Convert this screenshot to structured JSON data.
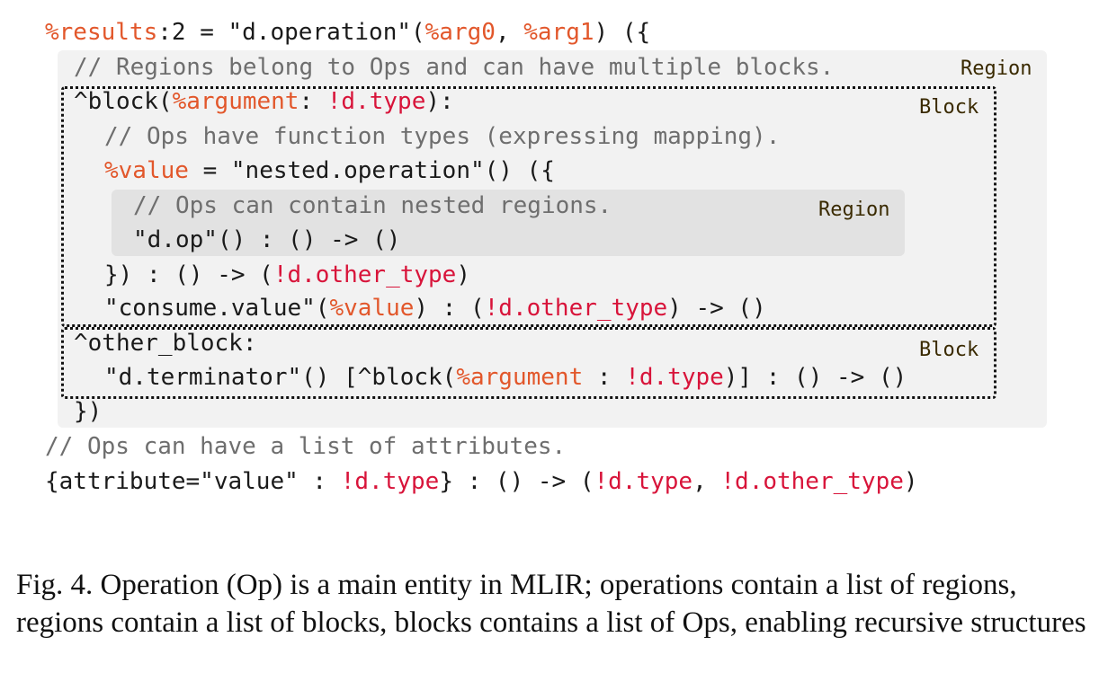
{
  "code": {
    "l1": {
      "a": "%results",
      "b": ":2 = \"d.operation\"(",
      "c": "%arg0",
      "d": ", ",
      "e": "%arg1",
      "f": ") ({"
    },
    "l2": "// Regions belong to Ops and can have multiple blocks.",
    "l3": {
      "a": "^block(",
      "b": "%argument",
      "c": ": ",
      "d": "!d.type",
      "e": "):"
    },
    "l4": "// Ops have function types (expressing mapping).",
    "l5": {
      "a": "%value",
      "b": " = \"nested.operation\"() ({"
    },
    "l6": "// Ops can contain nested regions.",
    "l7": "\"d.op\"() : () -> ()",
    "l8": {
      "a": "}) : () -> (",
      "b": "!d.other_type",
      "c": ")"
    },
    "l9": {
      "a": "\"consume.value\"(",
      "b": "%value",
      "c": ") : (",
      "d": "!d.other_type",
      "e": ") -> ()"
    },
    "l10": "^other_block:",
    "l11": {
      "a": "\"d.terminator\"() [^block(",
      "b": "%argument",
      "c": " : ",
      "d": "!d.type",
      "e": ")] : () -> ()"
    },
    "l12": "})",
    "l13": "// Ops can have a list of attributes.",
    "l14": {
      "a": "{attribute=\"value\" : ",
      "b": "!d.type",
      "c": "} : () -> (",
      "d": "!d.type",
      "e": ", ",
      "f": "!d.other_type",
      "g": ")"
    }
  },
  "tags": {
    "region_outer": "Region",
    "block_1": "Block",
    "region_inner": "Region",
    "block_2": "Block"
  },
  "caption": "Fig. 4.  Operation (Op) is a main entity in MLIR; operations contain a list of regions, regions contain a list of blocks, blocks contains a list of Ops, enabling recursive structures",
  "colors": {
    "variable": "#e2572b",
    "type": "#d8143a",
    "comment": "#6e6e6e",
    "region_bg": "#f2f2f2",
    "nested_region_bg": "#e2e2e2"
  }
}
